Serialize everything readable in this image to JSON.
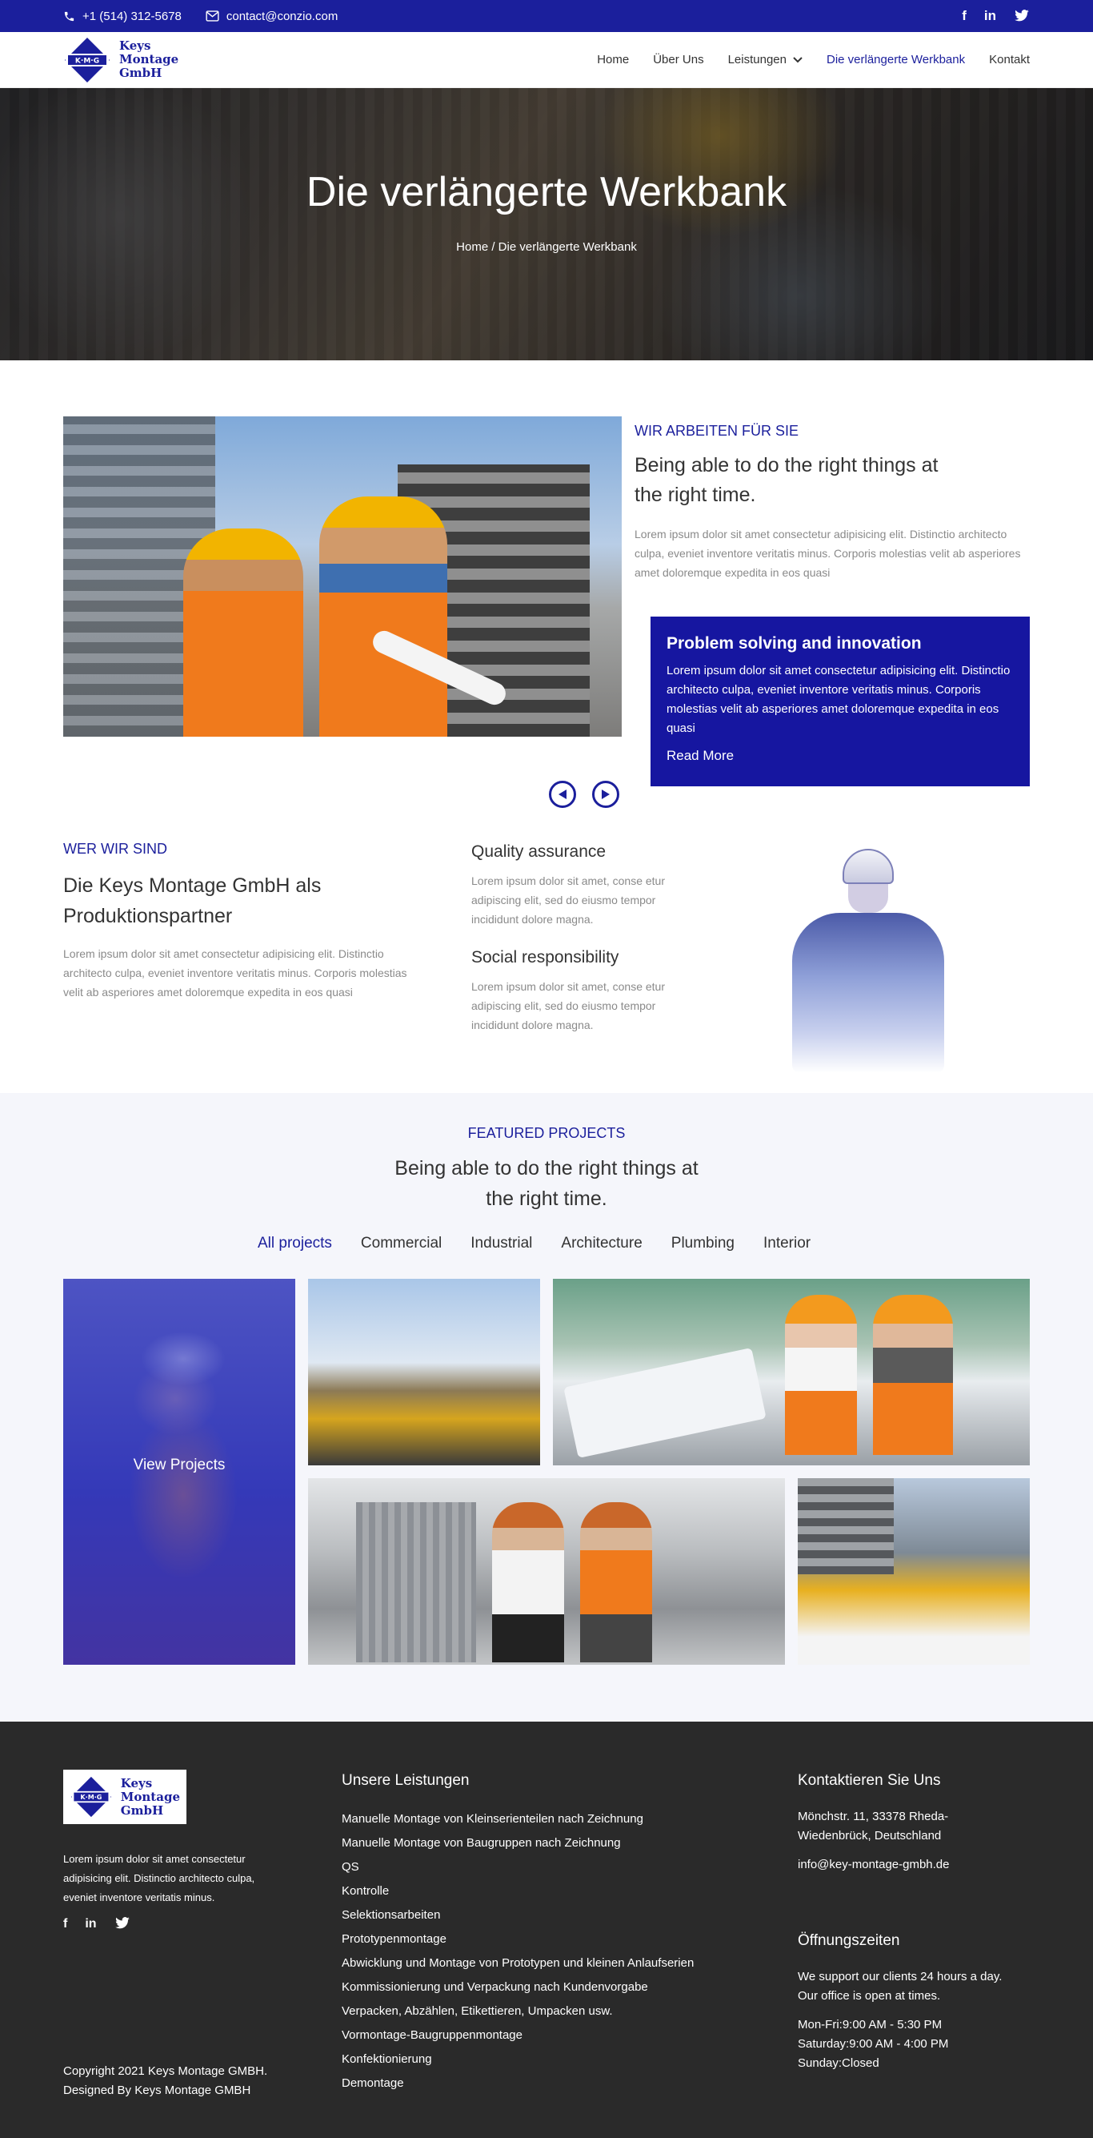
{
  "topbar": {
    "phone": "+1 (514) 312-5678",
    "email": "contact@conzio.com",
    "social": [
      "f",
      "in",
      "twitter-icon"
    ]
  },
  "brand": {
    "logo_mark": "K·M·G",
    "name_lines": [
      "Keys",
      "Montage",
      "GmbH"
    ],
    "accent": "#1b1f9c"
  },
  "nav": {
    "items": [
      {
        "label": "Home"
      },
      {
        "label": "Über Uns"
      },
      {
        "label": "Leistungen"
      },
      {
        "label": "Die verlängerte Werkbank"
      },
      {
        "label": "Kontakt"
      }
    ]
  },
  "hero": {
    "title": "Die verlängerte Werkbank",
    "breadcrumb": "Home / Die verlängerte Werkbank"
  },
  "about": {
    "eyebrow": "WIR ARBEITEN FÜR SIE",
    "heading": "Being able to do the right things at the right time.",
    "text": "Lorem ipsum dolor sit amet consectetur adipisicing elit. Distinctio architecto culpa, eveniet inventore veritatis minus. Corporis molestias velit ab asperiores amet doloremque expedita in eos quasi"
  },
  "bluebox": {
    "title": "Problem solving and innovation",
    "text": "Lorem ipsum dolor sit amet consectetur adipisicing elit. Distinctio architecto culpa, eveniet inventore veritatis minus. Corporis molestias velit ab asperiores amet doloremque expedita in eos quasi",
    "link": "Read More"
  },
  "who": {
    "eyebrow": "WER WIR SIND",
    "heading": "Die Keys Montage GmbH als Produktionspartner",
    "text": "Lorem ipsum dolor sit amet consectetur adipisicing elit. Distinctio architecto culpa, eveniet inventore veritatis minus. Corporis molestias velit ab asperiores amet doloremque expedita in eos quasi"
  },
  "features": [
    {
      "title": "Quality assurance",
      "text": "Lorem ipsum dolor sit amet, conse etur adipiscing elit, sed do eiusmo tempor incididunt dolore magna."
    },
    {
      "title": "Social responsibility",
      "text": "Lorem ipsum dolor sit amet, conse etur adipiscing elit, sed do eiusmo tempor incididunt dolore magna."
    }
  ],
  "projects": {
    "eyebrow": "FEATURED PROJECTS",
    "heading": "Being able to do the right things at the right time.",
    "filters": [
      "All projects",
      "Commercial",
      "Industrial",
      "Architecture",
      "Plumbing",
      "Interior"
    ],
    "overlay_label": "View Projects"
  },
  "footer": {
    "about": "Lorem ipsum dolor sit amet consectetur adipisicing elit. Distinctio architecto culpa, eveniet inventore veritatis minus.",
    "copyright": "Copyright 2021 Keys Montage GMBH.",
    "designed": "Designed By Keys Montage GMBH",
    "services_title": "Unsere Leistungen",
    "services": [
      "Manuelle Montage von Kleinserienteilen nach Zeichnung",
      "Manuelle Montage von Baugruppen nach Zeichnung",
      "QS",
      "Kontrolle",
      "Selektionsarbeiten",
      "Prototypenmontage",
      "Abwicklung und Montage von Prototypen und kleinen Anlaufserien",
      "Kommissionierung und Verpackung nach Kundenvorgabe",
      "Verpacken, Abzählen, Etikettieren, Umpacken usw.",
      "Vormontage-Baugruppenmontage",
      "Konfektionierung",
      "Demontage"
    ],
    "contact_title": "Kontaktieren Sie Uns",
    "address": "Mönchstr. 11, 33378 Rheda-Wiedenbrück, Deutschland",
    "email": "info@key-montage-gmbh.de",
    "hours_title": "Öffnungszeiten",
    "hours_intro": "We support our clients 24 hours a day. Our office is open at times.",
    "hours": [
      "Mon-Fri:9:00 AM - 5:30 PM",
      "Saturday:9:00 AM - 4:00 PM",
      "Sunday:Closed"
    ]
  }
}
